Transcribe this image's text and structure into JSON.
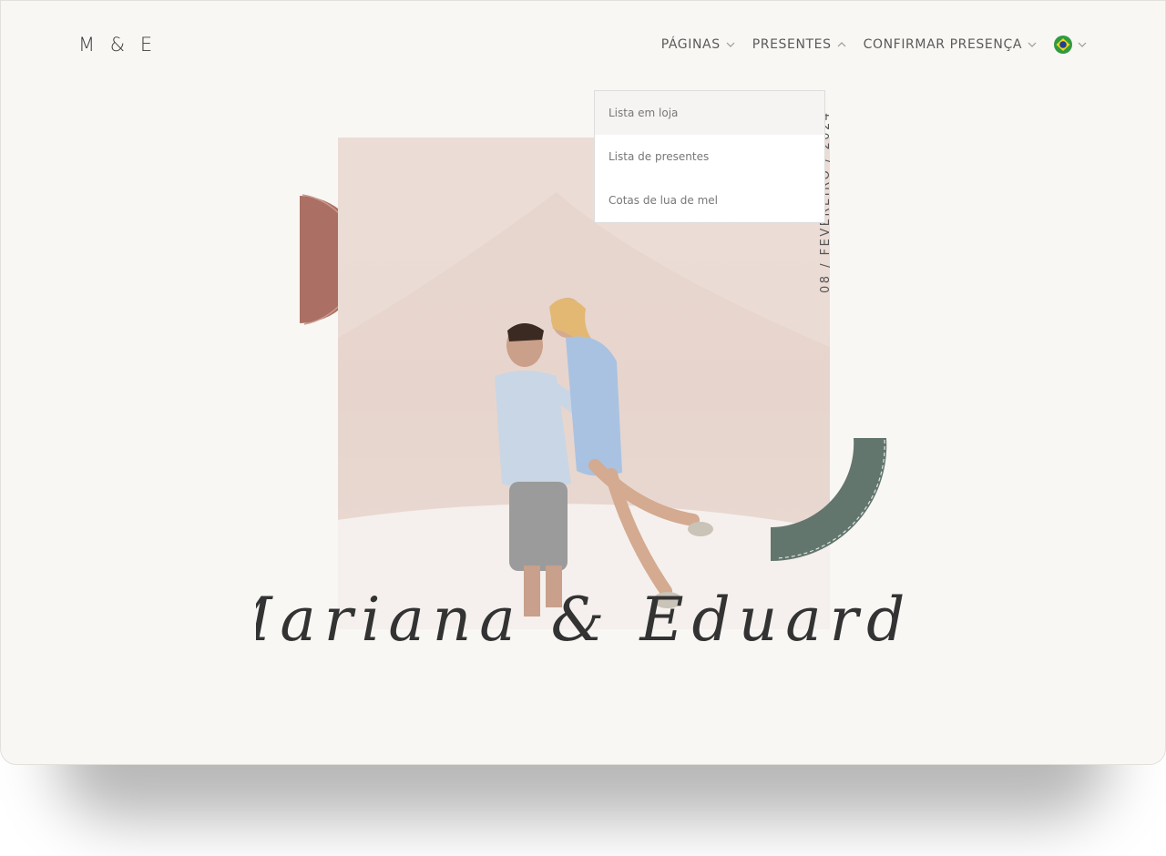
{
  "header": {
    "logo": "M & E"
  },
  "nav": {
    "items": [
      {
        "label": "PÁGINAS",
        "icon": "chevron-down-icon"
      },
      {
        "label": "PRESENTES",
        "icon": "chevron-up-icon"
      },
      {
        "label": "CONFIRMAR PRESENÇA",
        "icon": "chevron-down-icon"
      }
    ],
    "language_icon": "brazil-flag-icon"
  },
  "dropdown": {
    "items": [
      "Lista em loja",
      "Lista de presentes",
      "Cotas de lua de mel"
    ],
    "active_index": 0
  },
  "hero": {
    "date": "08 / FEVEREIRO / 2024",
    "names": "Mariana & Eduardo"
  },
  "colors": {
    "background": "#f9f7f4",
    "terracotta": "#ab6f63",
    "sage": "#62766e",
    "text": "#3c3c3c"
  }
}
